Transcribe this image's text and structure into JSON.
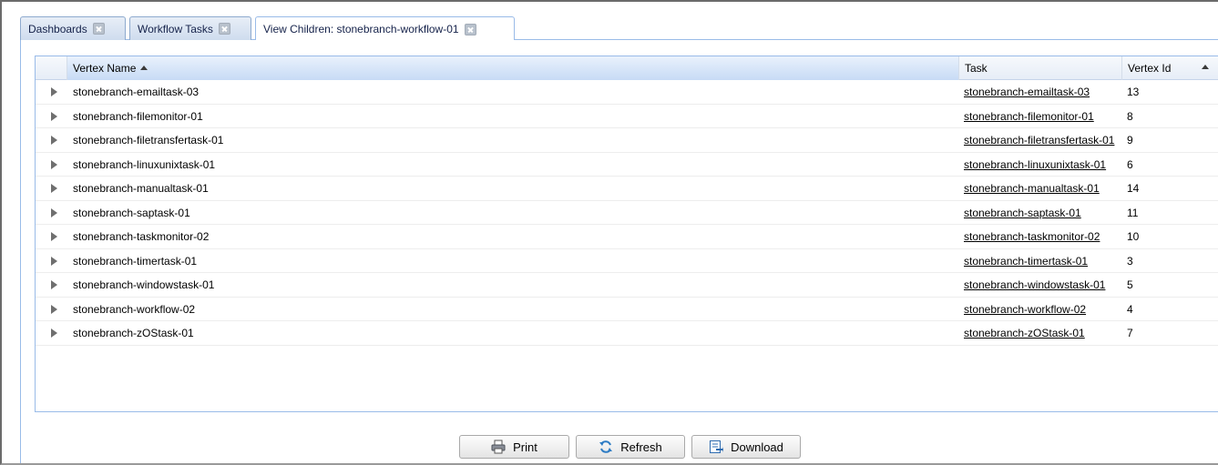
{
  "tabs": [
    {
      "label": "Dashboards"
    },
    {
      "label": "Workflow Tasks"
    },
    {
      "label": "View Children: stonebranch-workflow-01"
    }
  ],
  "grid": {
    "columns": {
      "name": "Vertex Name",
      "task": "Task",
      "vertex_id": "Vertex Id"
    },
    "sort": {
      "column": "Vertex Name",
      "direction": "ascending"
    },
    "rows": [
      {
        "name": "stonebranch-emailtask-03",
        "task": "stonebranch-emailtask-03",
        "vertex_id": "13"
      },
      {
        "name": "stonebranch-filemonitor-01",
        "task": "stonebranch-filemonitor-01",
        "vertex_id": "8"
      },
      {
        "name": "stonebranch-filetransfertask-01",
        "task": "stonebranch-filetransfertask-01",
        "vertex_id": "9"
      },
      {
        "name": "stonebranch-linuxunixtask-01",
        "task": "stonebranch-linuxunixtask-01",
        "vertex_id": "6"
      },
      {
        "name": "stonebranch-manualtask-01",
        "task": "stonebranch-manualtask-01",
        "vertex_id": "14"
      },
      {
        "name": "stonebranch-saptask-01",
        "task": "stonebranch-saptask-01",
        "vertex_id": "11"
      },
      {
        "name": "stonebranch-taskmonitor-02",
        "task": "stonebranch-taskmonitor-02",
        "vertex_id": "10"
      },
      {
        "name": "stonebranch-timertask-01",
        "task": "stonebranch-timertask-01",
        "vertex_id": "3"
      },
      {
        "name": "stonebranch-windowstask-01",
        "task": "stonebranch-windowstask-01",
        "vertex_id": "5"
      },
      {
        "name": "stonebranch-workflow-02",
        "task": "stonebranch-workflow-02",
        "vertex_id": "4"
      },
      {
        "name": "stonebranch-zOStask-01",
        "task": "stonebranch-zOStask-01",
        "vertex_id": "7"
      }
    ]
  },
  "buttons": {
    "print": "Print",
    "refresh": "Refresh",
    "download": "Download"
  },
  "icons": {
    "tab_close": "close-icon",
    "print": "printer-icon",
    "refresh": "refresh-icon",
    "download": "download-icon",
    "row_expand": "triangle-right-icon"
  },
  "colors": {
    "tab_border": "#8eaace",
    "grid_border": "#99bbe8",
    "sorted_header": "#c7dbf5"
  }
}
